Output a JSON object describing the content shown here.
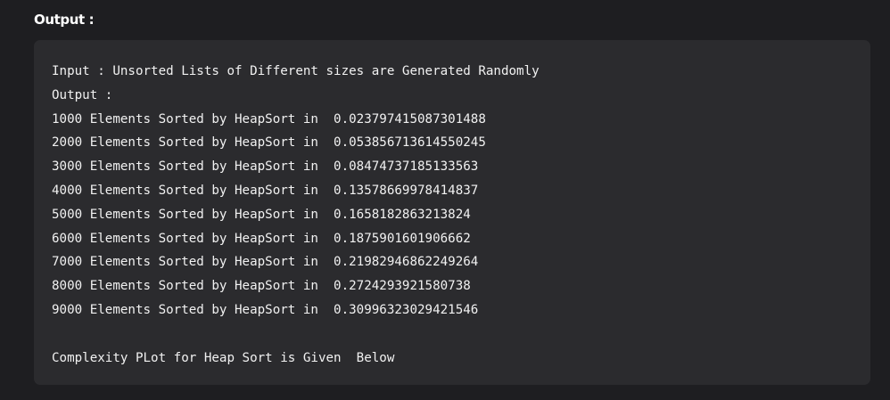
{
  "heading": "Output :",
  "code": {
    "lines": [
      "Input : Unsorted Lists of Different sizes are Generated Randomly",
      "Output :",
      "1000 Elements Sorted by HeapSort in  0.023797415087301488",
      "2000 Elements Sorted by HeapSort in  0.053856713614550245",
      "3000 Elements Sorted by HeapSort in  0.08474737185133563",
      "4000 Elements Sorted by HeapSort in  0.13578669978414837",
      "5000 Elements Sorted by HeapSort in  0.1658182863213824",
      "6000 Elements Sorted by HeapSort in  0.1875901601906662",
      "7000 Elements Sorted by HeapSort in  0.21982946862249264",
      "8000 Elements Sorted by HeapSort in  0.2724293921580738",
      "9000 Elements Sorted by HeapSort in  0.30996323029421546",
      "",
      "Complexity PLot for Heap Sort is Given  Below"
    ]
  }
}
